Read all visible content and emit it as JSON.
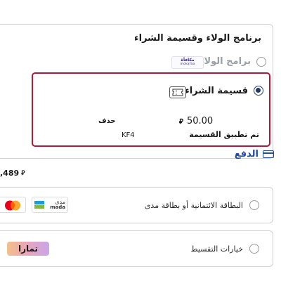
{
  "loyalty": {
    "title": "برنامج الولاء وقسيمة الشراء",
    "option_label": "برامج الولاء",
    "option_logo": {
      "name": "mokafaa-logo",
      "text_ar": "مكافأة",
      "text_en": "mokafaa"
    }
  },
  "installment_voucher": {
    "label": "قسيمة الشراء",
    "icon": "ticket-icon",
    "currency_symbol": "⃁",
    "amount": "50.00",
    "delete_label": "حذف",
    "applied_label": "تم تطبيق القسيمة",
    "applied_code": "KF4",
    "highlight_color": "#b0193a"
  },
  "payment": {
    "title": "الدفع",
    "icon": "credit-card-icon",
    "title_color": "#1f4aa8",
    "total_value": ",489",
    "currency_symbol": "⃁",
    "options": [
      {
        "label": "البطاقة الائتمانية أو بطاقة مدى",
        "logos": [
          {
            "name": "mada-logo",
            "text_ar": "مدى",
            "text_en": "mada"
          },
          {
            "name": "mastercard-logo"
          }
        ]
      },
      {
        "label": "خيارات التقسيط",
        "logos": [
          {
            "name": "tamara-logo",
            "text": "تمارا"
          }
        ]
      }
    ]
  }
}
